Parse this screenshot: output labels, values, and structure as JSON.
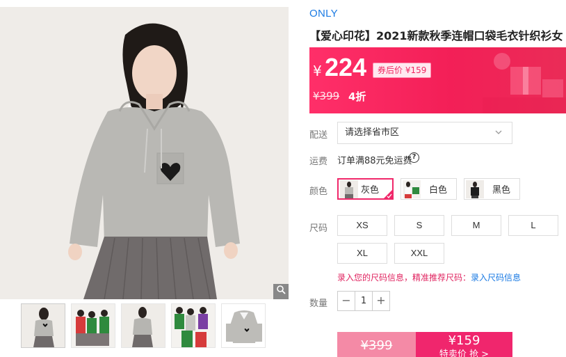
{
  "product": {
    "brand": "ONLY",
    "title": "【爱心印花】2021新款秋季连帽口袋毛衣针织衫女"
  },
  "price": {
    "currency_symbol": "¥",
    "current": "224",
    "coupon_label": "券后价 ¥159",
    "original": "¥399",
    "discount": "4折"
  },
  "delivery": {
    "label": "配送",
    "placeholder": "请选择省市区"
  },
  "shipping": {
    "label": "运费",
    "text": "订单满88元免运费",
    "help_glyph": "?"
  },
  "colors": {
    "label": "颜色",
    "options": [
      {
        "name": "灰色",
        "selected": true
      },
      {
        "name": "白色",
        "selected": false
      },
      {
        "name": "黑色",
        "selected": false
      }
    ]
  },
  "sizes": {
    "label": "尺码",
    "options": [
      "XS",
      "S",
      "M",
      "L",
      "XL",
      "XXL"
    ],
    "hint": "录入您的尺码信息，精准推荐尺码：",
    "hint_link": "录入尺码信息"
  },
  "quantity": {
    "label": "数量",
    "value": "1",
    "minus": "−",
    "plus": "+"
  },
  "buy": {
    "original_price": "¥399",
    "coupon_price": "¥159",
    "coupon_text": "特卖价 抢 >"
  },
  "theme": {
    "accent": "#f0286a",
    "brand_blue": "#1a7ae3",
    "banner_start": "#ff2f69"
  },
  "icons": {
    "zoom": "magnifier-icon",
    "chevron": "chevron-down-icon",
    "help": "question-circle-icon",
    "check": "checkmark-corner-icon"
  }
}
